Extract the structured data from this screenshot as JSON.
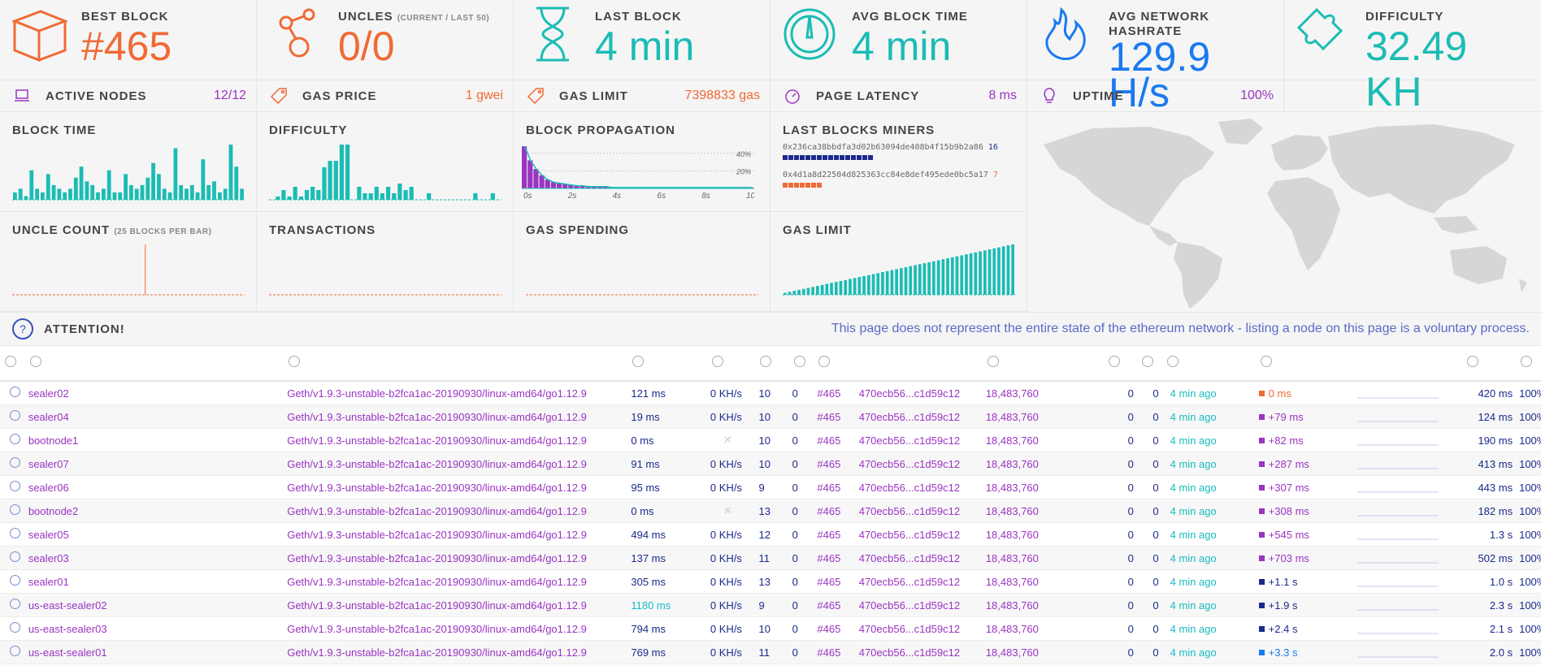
{
  "colors": {
    "orange": "#f06a35",
    "teal": "#1bbcb4",
    "blue": "#1a7af0",
    "purple": "#9a34c2",
    "navy": "#1b2a8a",
    "gray": "#444"
  },
  "stats": [
    {
      "title": "BEST BLOCK",
      "sub": "",
      "value": "#465",
      "color": "#f06a35",
      "icon": "cube-icon"
    },
    {
      "title": "UNCLES",
      "sub": "(CURRENT / LAST 50)",
      "value": "0/0",
      "color": "#f06a35",
      "icon": "uncles-icon"
    },
    {
      "title": "LAST BLOCK",
      "sub": "",
      "value": "4 min",
      "color": "#1bbcb4",
      "icon": "hourglass-icon"
    },
    {
      "title": "AVG BLOCK TIME",
      "sub": "",
      "value": "4 min",
      "color": "#1bbcb4",
      "icon": "gauge-icon"
    },
    {
      "title": "AVG NETWORK HASHRATE",
      "sub": "",
      "value": "129.9 H/s",
      "color": "#1a7af0",
      "icon": "flame-icon"
    },
    {
      "title": "DIFFICULTY",
      "sub": "",
      "value": "32.49 KH",
      "color": "#1bbcb4",
      "icon": "puzzle-icon"
    }
  ],
  "mini": [
    {
      "label": "ACTIVE NODES",
      "value": "12/12",
      "color": "#9a34c2",
      "icon": "laptop-icon"
    },
    {
      "label": "GAS PRICE",
      "value": "1 gwei",
      "color": "#f06a35",
      "icon": "tag-icon"
    },
    {
      "label": "GAS LIMIT",
      "value": "7398833 gas",
      "color": "#f06a35",
      "icon": "tag-icon"
    },
    {
      "label": "PAGE LATENCY",
      "value": "8 ms",
      "color": "#9a34c2",
      "icon": "timer-icon"
    },
    {
      "label": "UPTIME",
      "value": "100%",
      "color": "#9a34c2",
      "icon": "bulb-icon"
    }
  ],
  "charts": {
    "block_time": {
      "title": "BLOCK TIME"
    },
    "difficulty": {
      "title": "DIFFICULTY"
    },
    "propagation": {
      "title": "BLOCK PROPAGATION",
      "xticks": [
        "0s",
        "2s",
        "4s",
        "6s",
        "8s",
        "10s"
      ],
      "yticks": [
        "40%",
        "20%"
      ]
    },
    "miners": {
      "title": "LAST BLOCKS MINERS",
      "items": [
        {
          "address": "0x236ca38bbdfa3d02b63094de408b4f15b9b2a86",
          "count": "16",
          "color": "#1b2a8a"
        },
        {
          "address": "0x4d1a8d22504d825363cc84e8def495ede0bc5a17",
          "count": "7",
          "color": "#f06a35"
        }
      ]
    },
    "uncle_count": {
      "title": "UNCLE COUNT",
      "sub": "(25 BLOCKS PER BAR)"
    },
    "transactions": {
      "title": "TRANSACTIONS"
    },
    "gas_spending": {
      "title": "GAS SPENDING"
    },
    "gas_limit": {
      "title": "GAS LIMIT"
    }
  },
  "chart_data": [
    {
      "type": "bar",
      "title": "BLOCK TIME",
      "values": [
        2,
        3,
        1,
        8,
        3,
        2,
        7,
        4,
        3,
        2,
        3,
        6,
        9,
        5,
        4,
        2,
        3,
        8,
        2,
        2,
        7,
        4,
        3,
        4,
        6,
        10,
        7,
        3,
        2,
        14,
        4,
        3,
        4,
        2,
        11,
        4,
        5,
        2,
        3,
        15,
        9,
        3
      ]
    },
    {
      "type": "bar",
      "title": "DIFFICULTY",
      "values": [
        0,
        1,
        3,
        1,
        4,
        1,
        3,
        4,
        3,
        10,
        12,
        12,
        17,
        17,
        0,
        4,
        2,
        2,
        4,
        2,
        4,
        2,
        5,
        3,
        4,
        0,
        0,
        2,
        0,
        0,
        0,
        0,
        0,
        0,
        0,
        2,
        0,
        0,
        2,
        0
      ]
    },
    {
      "type": "bar",
      "title": "BLOCK PROPAGATION",
      "values": [
        48,
        32,
        22,
        15,
        10,
        7,
        6,
        5,
        4,
        3,
        3,
        2,
        2,
        2,
        2,
        1,
        1,
        1,
        1,
        1,
        1,
        1,
        1,
        1,
        1,
        1,
        1,
        1,
        1,
        1,
        1,
        1,
        1,
        1,
        1,
        1,
        1,
        1,
        1,
        1
      ],
      "ylim": [
        0,
        50
      ]
    },
    {
      "type": "bar",
      "title": "UNCLE COUNT",
      "values": [
        0,
        0,
        0,
        0,
        0,
        0,
        0,
        0,
        0,
        0,
        0,
        0,
        0,
        0,
        0,
        0,
        0,
        0,
        0,
        0,
        0,
        0,
        0,
        0,
        0,
        0,
        0,
        0,
        0,
        0,
        0,
        0,
        0,
        0,
        0,
        0,
        0,
        0,
        0,
        0,
        0,
        0,
        0,
        0,
        0,
        0,
        0,
        0,
        0,
        0,
        0,
        0,
        0,
        0,
        0,
        1,
        0,
        0,
        0,
        0,
        0,
        0,
        0,
        0,
        0,
        0,
        0,
        0,
        0,
        0,
        0,
        0,
        0,
        0,
        0,
        0,
        0,
        0,
        0,
        0,
        0,
        0,
        0,
        0,
        0,
        0,
        0,
        0,
        0,
        0,
        0,
        0,
        0,
        0,
        0,
        0,
        0
      ]
    },
    {
      "type": "bar",
      "title": "TRANSACTIONS",
      "values": []
    },
    {
      "type": "bar",
      "title": "GAS SPENDING",
      "values": []
    },
    {
      "type": "bar",
      "title": "GAS LIMIT",
      "values": [
        2,
        3,
        4,
        5,
        6,
        7,
        8,
        9,
        10,
        11,
        12,
        13,
        14,
        15,
        16,
        17,
        18,
        19,
        20,
        21,
        22,
        23,
        24,
        25,
        26,
        27,
        28,
        29,
        30,
        31,
        32,
        33,
        34,
        35,
        36,
        37,
        38,
        39,
        40,
        41,
        42,
        43,
        44,
        45,
        46,
        47,
        48,
        49,
        50,
        51
      ]
    }
  ],
  "attention": {
    "label": "ATTENTION!",
    "message": "This page does not represent the entire state of the ethereum network - listing a node on this page is a voluntary process."
  },
  "table": {
    "header_icons": [
      "pin-icon",
      "laptop-icon",
      "laptop-icon",
      "latency-icon",
      "pickaxe-icon",
      "peers-icon",
      "pending-icon",
      "cube-icon",
      "gas-icon",
      "check-icon",
      "uncles-icon",
      "hourglass-icon",
      "propagation-icon",
      "propagation-icon",
      "bulb-icon"
    ],
    "rows": [
      {
        "name": "sealer02",
        "client": "Geth/v1.9.3-unstable-b2fca1ac-20190930/linux-amd64/go1.12.9",
        "latency": "121 ms",
        "latency_color": "#1b2a8a",
        "mining": "0 KH/s",
        "peers": "10",
        "pending": "0",
        "block": "#465",
        "hash": "470ecb56...c1d59c12",
        "gas": "18,483,760",
        "txs": "0",
        "uncles": "0",
        "last_block": "4 min ago",
        "prop": "0 ms",
        "prop_color": "#f06a35",
        "avg_prop": "420 ms",
        "uptime": "100%"
      },
      {
        "name": "sealer04",
        "client": "Geth/v1.9.3-unstable-b2fca1ac-20190930/linux-amd64/go1.12.9",
        "latency": "19 ms",
        "latency_color": "#1b2a8a",
        "mining": "0 KH/s",
        "peers": "10",
        "pending": "0",
        "block": "#465",
        "hash": "470ecb56...c1d59c12",
        "gas": "18,483,760",
        "txs": "0",
        "uncles": "0",
        "last_block": "4 min ago",
        "prop": "+79 ms",
        "prop_color": "#9a34c2",
        "avg_prop": "124 ms",
        "uptime": "100%"
      },
      {
        "name": "bootnode1",
        "client": "Geth/v1.9.3-unstable-b2fca1ac-20190930/linux-amd64/go1.12.9",
        "latency": "0 ms",
        "latency_color": "#1b2a8a",
        "mining": "",
        "peers": "10",
        "pending": "0",
        "block": "#465",
        "hash": "470ecb56...c1d59c12",
        "gas": "18,483,760",
        "txs": "0",
        "uncles": "0",
        "last_block": "4 min ago",
        "prop": "+82 ms",
        "prop_color": "#9a34c2",
        "avg_prop": "190 ms",
        "uptime": "100%"
      },
      {
        "name": "sealer07",
        "client": "Geth/v1.9.3-unstable-b2fca1ac-20190930/linux-amd64/go1.12.9",
        "latency": "91 ms",
        "latency_color": "#1b2a8a",
        "mining": "0 KH/s",
        "peers": "10",
        "pending": "0",
        "block": "#465",
        "hash": "470ecb56...c1d59c12",
        "gas": "18,483,760",
        "txs": "0",
        "uncles": "0",
        "last_block": "4 min ago",
        "prop": "+287 ms",
        "prop_color": "#9a34c2",
        "avg_prop": "413 ms",
        "uptime": "100%"
      },
      {
        "name": "sealer06",
        "client": "Geth/v1.9.3-unstable-b2fca1ac-20190930/linux-amd64/go1.12.9",
        "latency": "95 ms",
        "latency_color": "#1b2a8a",
        "mining": "0 KH/s",
        "peers": "9",
        "pending": "0",
        "block": "#465",
        "hash": "470ecb56...c1d59c12",
        "gas": "18,483,760",
        "txs": "0",
        "uncles": "0",
        "last_block": "4 min ago",
        "prop": "+307 ms",
        "prop_color": "#9a34c2",
        "avg_prop": "443 ms",
        "uptime": "100%"
      },
      {
        "name": "bootnode2",
        "client": "Geth/v1.9.3-unstable-b2fca1ac-20190930/linux-amd64/go1.12.9",
        "latency": "0 ms",
        "latency_color": "#1b2a8a",
        "mining": "",
        "peers": "13",
        "pending": "0",
        "block": "#465",
        "hash": "470ecb56...c1d59c12",
        "gas": "18,483,760",
        "txs": "0",
        "uncles": "0",
        "last_block": "4 min ago",
        "prop": "+308 ms",
        "prop_color": "#9a34c2",
        "avg_prop": "182 ms",
        "uptime": "100%"
      },
      {
        "name": "sealer05",
        "client": "Geth/v1.9.3-unstable-b2fca1ac-20190930/linux-amd64/go1.12.9",
        "latency": "494 ms",
        "latency_color": "#1b2a8a",
        "mining": "0 KH/s",
        "peers": "12",
        "pending": "0",
        "block": "#465",
        "hash": "470ecb56...c1d59c12",
        "gas": "18,483,760",
        "txs": "0",
        "uncles": "0",
        "last_block": "4 min ago",
        "prop": "+545 ms",
        "prop_color": "#9a34c2",
        "avg_prop": "1.3 s",
        "uptime": "100%"
      },
      {
        "name": "sealer03",
        "client": "Geth/v1.9.3-unstable-b2fca1ac-20190930/linux-amd64/go1.12.9",
        "latency": "137 ms",
        "latency_color": "#1b2a8a",
        "mining": "0 KH/s",
        "peers": "11",
        "pending": "0",
        "block": "#465",
        "hash": "470ecb56...c1d59c12",
        "gas": "18,483,760",
        "txs": "0",
        "uncles": "0",
        "last_block": "4 min ago",
        "prop": "+703 ms",
        "prop_color": "#9a34c2",
        "avg_prop": "502 ms",
        "uptime": "100%"
      },
      {
        "name": "sealer01",
        "client": "Geth/v1.9.3-unstable-b2fca1ac-20190930/linux-amd64/go1.12.9",
        "latency": "305 ms",
        "latency_color": "#1b2a8a",
        "mining": "0 KH/s",
        "peers": "13",
        "pending": "0",
        "block": "#465",
        "hash": "470ecb56...c1d59c12",
        "gas": "18,483,760",
        "txs": "0",
        "uncles": "0",
        "last_block": "4 min ago",
        "prop": "+1.1 s",
        "prop_color": "#1b2a8a",
        "avg_prop": "1.0 s",
        "uptime": "100%"
      },
      {
        "name": "us-east-sealer02",
        "client": "Geth/v1.9.3-unstable-b2fca1ac-20190930/linux-amd64/go1.12.9",
        "latency": "1180 ms",
        "latency_color": "#19bbc0",
        "mining": "0 KH/s",
        "peers": "9",
        "pending": "0",
        "block": "#465",
        "hash": "470ecb56...c1d59c12",
        "gas": "18,483,760",
        "txs": "0",
        "uncles": "0",
        "last_block": "4 min ago",
        "prop": "+1.9 s",
        "prop_color": "#1b2a8a",
        "avg_prop": "2.3 s",
        "uptime": "100%"
      },
      {
        "name": "us-east-sealer03",
        "client": "Geth/v1.9.3-unstable-b2fca1ac-20190930/linux-amd64/go1.12.9",
        "latency": "794 ms",
        "latency_color": "#1b2a8a",
        "mining": "0 KH/s",
        "peers": "10",
        "pending": "0",
        "block": "#465",
        "hash": "470ecb56...c1d59c12",
        "gas": "18,483,760",
        "txs": "0",
        "uncles": "0",
        "last_block": "4 min ago",
        "prop": "+2.4 s",
        "prop_color": "#1b2a8a",
        "avg_prop": "2.1 s",
        "uptime": "100%"
      },
      {
        "name": "us-east-sealer01",
        "client": "Geth/v1.9.3-unstable-b2fca1ac-20190930/linux-amd64/go1.12.9",
        "latency": "769 ms",
        "latency_color": "#1b2a8a",
        "mining": "0 KH/s",
        "peers": "11",
        "pending": "0",
        "block": "#465",
        "hash": "470ecb56...c1d59c12",
        "gas": "18,483,760",
        "txs": "0",
        "uncles": "0",
        "last_block": "4 min ago",
        "prop": "+3.3 s",
        "prop_color": "#1a7af0",
        "avg_prop": "2.0 s",
        "uptime": "100%"
      }
    ]
  }
}
